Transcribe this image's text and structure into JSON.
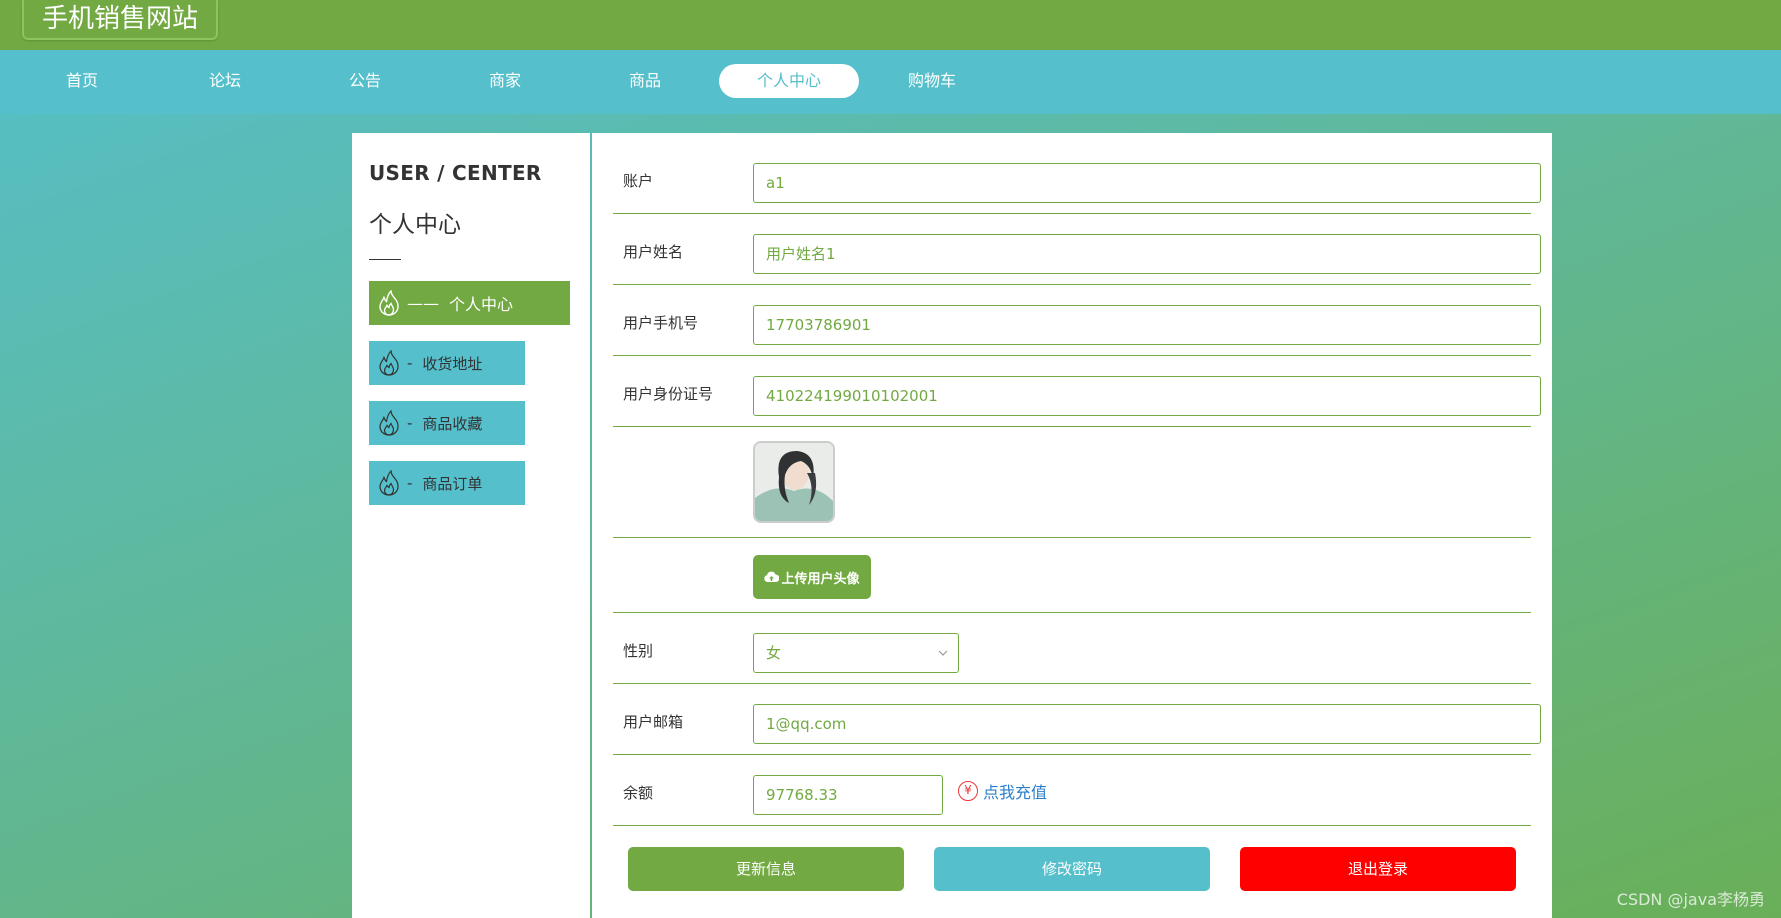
{
  "site": {
    "title": "手机销售网站"
  },
  "nav": {
    "items": [
      {
        "label": "首页"
      },
      {
        "label": "论坛"
      },
      {
        "label": "公告"
      },
      {
        "label": "商家"
      },
      {
        "label": "商品"
      },
      {
        "label": "个人中心",
        "active": true
      },
      {
        "label": "购物车"
      }
    ]
  },
  "sidebar": {
    "title_en": "USER / CENTER",
    "title_cn": "个人中心",
    "items": [
      {
        "label": "个人中心",
        "dash": "——",
        "active": true,
        "icon": "flame-icon"
      },
      {
        "label": "收货地址",
        "dash": "-",
        "icon": "flame-icon"
      },
      {
        "label": "商品收藏",
        "dash": "-",
        "icon": "flame-icon"
      },
      {
        "label": "商品订单",
        "dash": "-",
        "icon": "flame-icon"
      }
    ]
  },
  "form": {
    "account": {
      "label": "账户",
      "value": "a1"
    },
    "name": {
      "label": "用户姓名",
      "value": "用户姓名1"
    },
    "phone": {
      "label": "用户手机号",
      "value": "17703786901"
    },
    "idcard": {
      "label": "用户身份证号",
      "value": "410224199010102001"
    },
    "upload": {
      "label": "上传用户头像",
      "icon": "cloud-upload-icon"
    },
    "gender": {
      "label": "性别",
      "value": "女"
    },
    "email": {
      "label": "用户邮箱",
      "value": "1@qq.com"
    },
    "balance": {
      "label": "余额",
      "value": "97768.33",
      "recharge_label": "点我充值",
      "recharge_icon": "¥"
    }
  },
  "actions": {
    "update": "更新信息",
    "password": "修改密码",
    "logout": "退出登录"
  },
  "colors": {
    "green": "#72a942",
    "teal": "#55bfcb",
    "red": "#ff0000",
    "link": "#2b7ecb"
  },
  "watermark": "CSDN @java李杨勇"
}
